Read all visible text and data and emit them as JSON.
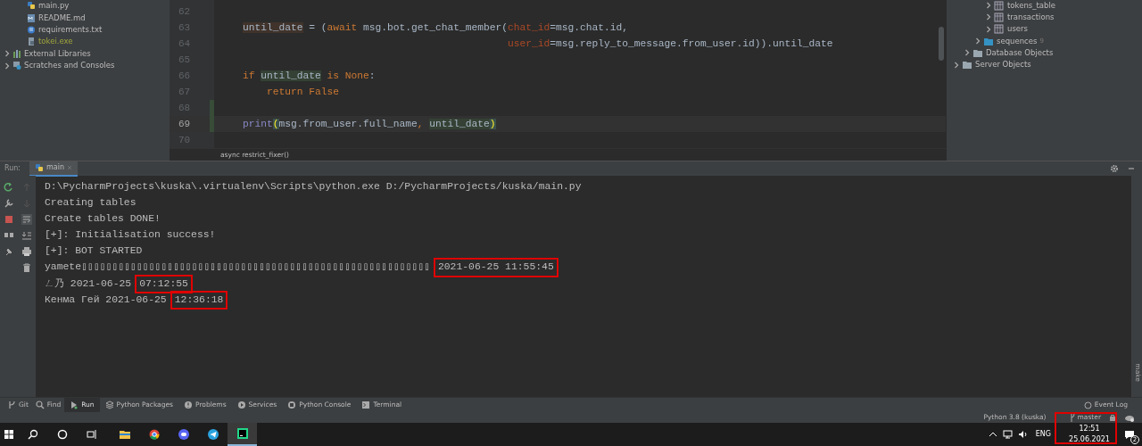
{
  "project_tree": [
    {
      "label": "main.py",
      "kind": "python",
      "ignored": false
    },
    {
      "label": "README.md",
      "kind": "markdown",
      "ignored": false
    },
    {
      "label": "requirements.txt",
      "kind": "text",
      "ignored": false
    },
    {
      "label": "tokei.exe",
      "kind": "exe",
      "ignored": true
    },
    {
      "label": "External Libraries",
      "kind": "library",
      "expanded": false
    },
    {
      "label": "Scratches and Consoles",
      "kind": "scratches",
      "expanded": false
    }
  ],
  "editor": {
    "lines": [
      {
        "number": "62",
        "current": false,
        "changed": false
      },
      {
        "number": "63",
        "current": false,
        "changed": false,
        "tokens": [
          {
            "text": "until_date",
            "kind": "write"
          },
          {
            "text": " = (",
            "kind": "plain"
          },
          {
            "text": "await",
            "kind": "keyword"
          },
          {
            "text": " msg.bot.get_chat_member(",
            "kind": "plain"
          },
          {
            "text": "chat_id",
            "kind": "param"
          },
          {
            "text": "=msg.chat.id,",
            "kind": "plain"
          }
        ]
      },
      {
        "number": "64",
        "current": false,
        "changed": false,
        "tokens": [
          {
            "text": "                                            user_id",
            "kind": "param"
          },
          {
            "text": "=msg.reply_to_message.from_user.id)).until_date",
            "kind": "plain"
          }
        ]
      },
      {
        "number": "65",
        "current": false,
        "changed": false
      },
      {
        "number": "66",
        "current": false,
        "changed": false,
        "tokens": [
          {
            "text": "if ",
            "kind": "keyword"
          },
          {
            "text": "until_date",
            "kind": "read"
          },
          {
            "text": " is None",
            "kind": "keyword"
          },
          {
            "text": ":",
            "kind": "plain"
          }
        ]
      },
      {
        "number": "67",
        "current": false,
        "changed": false,
        "tokens": [
          {
            "text": "    return False",
            "kind": "keyword"
          }
        ]
      },
      {
        "number": "68",
        "current": false,
        "changed": true
      },
      {
        "number": "69",
        "current": true,
        "changed": true,
        "tokens": [
          {
            "text": "print",
            "kind": "builtin"
          },
          {
            "text": "(",
            "kind": "brace"
          },
          {
            "text": "msg.from_user.full_name",
            "kind": "plain"
          },
          {
            "text": ", ",
            "kind": "keyword"
          },
          {
            "text": "until_date",
            "kind": "read"
          },
          {
            "text": ")",
            "kind": "brace"
          }
        ]
      },
      {
        "number": "70",
        "current": false,
        "changed": false
      }
    ],
    "breadcrumb": "async restrict_fixer()"
  },
  "database_tree": [
    {
      "children": [
        {
          "children": [
            {
              "children": [
                {
                  "label": "tokens_table",
                  "kind": "table",
                  "expanded": false
                },
                {
                  "label": "transactions",
                  "kind": "table",
                  "expanded": false
                },
                {
                  "label": "users",
                  "kind": "table",
                  "expanded": false
                }
              ]
            },
            {
              "label": "sequences",
              "count": "9",
              "kind": "folder",
              "expanded": false
            }
          ]
        },
        {
          "label": "Database Objects",
          "kind": "folder",
          "expanded": false
        }
      ]
    },
    {
      "label": "Server Objects",
      "kind": "folder",
      "expanded": false
    }
  ],
  "run_panel": {
    "label": "Run:",
    "tabs": [
      {
        "label": "main",
        "selected": true
      }
    ],
    "lines": [
      {
        "parts": [
          {
            "text": "D:\\PycharmProjects\\kuska\\.virtualenv\\Scripts\\python.exe D:/PycharmProjects/kuska/main.py",
            "boxed": false
          }
        ]
      },
      {
        "parts": [
          {
            "text": "Creating tables",
            "boxed": false
          }
        ]
      },
      {
        "parts": [
          {
            "text": "Create tables DONE!",
            "boxed": false
          }
        ]
      },
      {
        "parts": [
          {
            "text": "[+]: Initialisation success!",
            "boxed": false
          }
        ]
      },
      {
        "parts": [
          {
            "text": "[+]: BOT STARTED",
            "boxed": false
          }
        ]
      },
      {
        "parts": [
          {
            "text": "yamete▯▯▯▯▯▯▯▯▯▯▯▯▯▯▯▯▯▯▯▯▯▯▯▯▯▯▯▯▯▯▯▯▯▯▯▯▯▯▯▯▯▯▯▯▯▯▯▯▯▯▯▯▯▯▯▯▯",
            "boxed": false
          },
          {
            "text": "2021-06-25 11:55:45",
            "boxed": true
          }
        ]
      },
      {
        "parts": [
          {
            "text": "ㄥ乃 2021-06-25",
            "boxed": false
          },
          {
            "text": "07:12:55",
            "boxed": true
          }
        ]
      },
      {
        "parts": [
          {
            "text": "Кенма Гей 2021-06-25",
            "boxed": false
          },
          {
            "text": "12:36:18",
            "boxed": true
          }
        ]
      }
    ],
    "side_label": "make"
  },
  "tool_windows": [
    {
      "label": "Git",
      "kind": "git",
      "selected": false
    },
    {
      "label": "Find",
      "kind": "find",
      "selected": false
    },
    {
      "label": "Run",
      "kind": "run",
      "selected": true
    },
    {
      "label": "Python Packages",
      "kind": "packages",
      "selected": false
    },
    {
      "label": "Problems",
      "kind": "problems",
      "selected": false
    },
    {
      "label": "Services",
      "kind": "services",
      "selected": false
    },
    {
      "label": "Python Console",
      "kind": "console",
      "selected": false
    },
    {
      "label": "Terminal",
      "kind": "terminal",
      "selected": false
    }
  ],
  "event_log": "Event Log",
  "status_bar": {
    "interpreter": "Python 3.8 (kuska)",
    "branch": "master"
  },
  "taskbar": {
    "apps": [
      {
        "kind": "search",
        "active": false
      },
      {
        "kind": "cortana",
        "active": false
      },
      {
        "kind": "taskview",
        "active": false
      },
      {
        "kind": "explorer",
        "active": false
      },
      {
        "kind": "chrome",
        "active": false
      },
      {
        "kind": "discord",
        "active": false
      },
      {
        "kind": "telegram",
        "active": false
      },
      {
        "kind": "pycharm",
        "active": true
      }
    ],
    "language": "ENG",
    "time": "12:51",
    "date": "25.06.2021",
    "clock_boxed": true,
    "notifications": "2"
  }
}
